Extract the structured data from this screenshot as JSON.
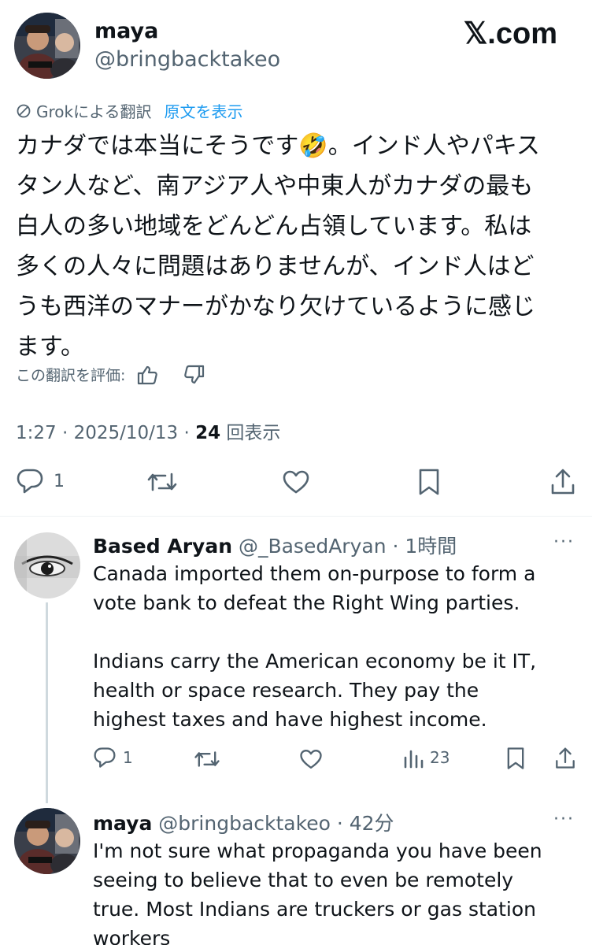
{
  "tweet": {
    "author_name": "maya",
    "author_handle": "@bringbacktakeo",
    "brand": "𝕏.com",
    "translation_label": "Grokによる翻訳",
    "show_original": "原文を表示",
    "body_lines": [
      "カナダでは本当にそうです🤣。インド人やパキス",
      "タン人など、南アジア人や中東人がカナダの最も",
      "白人の多い地域をどんどん占領しています。私は",
      "多くの人々に問題はありませんが、インド人はど",
      "うも西洋のマナーがかなり欠けているように感じ",
      "ます。"
    ],
    "rate_label": "この翻訳を評価:",
    "time": "1:27 · 2025/10/13 · ",
    "views_count": "24",
    "views_label": "回表示",
    "reply_count": "1"
  },
  "replies": [
    {
      "name": "Based Aryan",
      "handle": " @_BasedAryan · 1時間",
      "paragraph1": [
        "Canada imported them on-purpose to form a",
        "vote bank to defeat the Right Wing parties."
      ],
      "paragraph2": [
        "Indians carry the American economy be it IT,",
        "health or space research. They pay the",
        "highest taxes and have highest income."
      ],
      "reply_count": "1",
      "views": "23",
      "more": "···"
    },
    {
      "name": "maya",
      "handle": " @bringbacktakeo · 42分",
      "lines": [
        "I'm not sure what propaganda you have been",
        "seeing to believe that to even be remotely",
        "true. Most Indians are truckers or gas station",
        "workers"
      ],
      "more": "···"
    }
  ],
  "icons": {
    "translate": "translate-icon",
    "thumbs_up": "thumbs-up-icon",
    "thumbs_down": "thumbs-down-icon",
    "reply": "reply-icon",
    "retweet": "retweet-icon",
    "like": "like-icon",
    "bookmark": "bookmark-icon",
    "share": "share-icon",
    "views": "views-icon"
  },
  "colors": {
    "link": "#1d9bf0",
    "secondary_text": "#536471",
    "primary_text": "#0f1419"
  }
}
